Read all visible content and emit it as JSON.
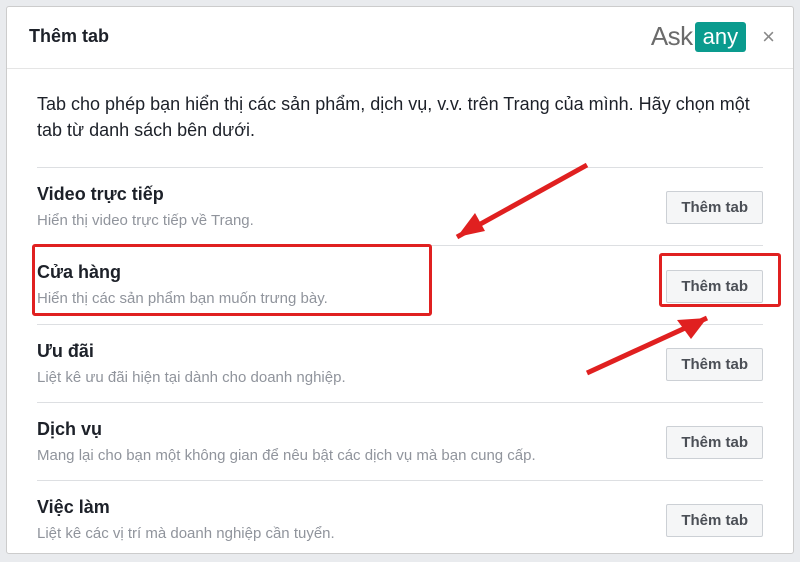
{
  "header": {
    "title": "Thêm tab",
    "logo_left": "Ask",
    "logo_right": "any",
    "close_label": "×"
  },
  "description": "Tab cho phép bạn hiển thị các sản phẩm, dịch vụ, v.v. trên Trang của mình. Hãy chọn một tab từ danh sách bên dưới.",
  "button_label": "Thêm tab",
  "tabs": [
    {
      "title": "Video trực tiếp",
      "desc": "Hiển thị video trực tiếp về Trang."
    },
    {
      "title": "Cửa hàng",
      "desc": "Hiển thị các sản phẩm bạn muốn trưng bày."
    },
    {
      "title": "Ưu đãi",
      "desc": "Liệt kê ưu đãi hiện tại dành cho doanh nghiệp."
    },
    {
      "title": "Dịch vụ",
      "desc": "Mang lại cho bạn một không gian để nêu bật các dịch vụ mà bạn cung cấp."
    },
    {
      "title": "Việc làm",
      "desc": "Liệt kê các vị trí mà doanh nghiệp cần tuyển."
    }
  ]
}
